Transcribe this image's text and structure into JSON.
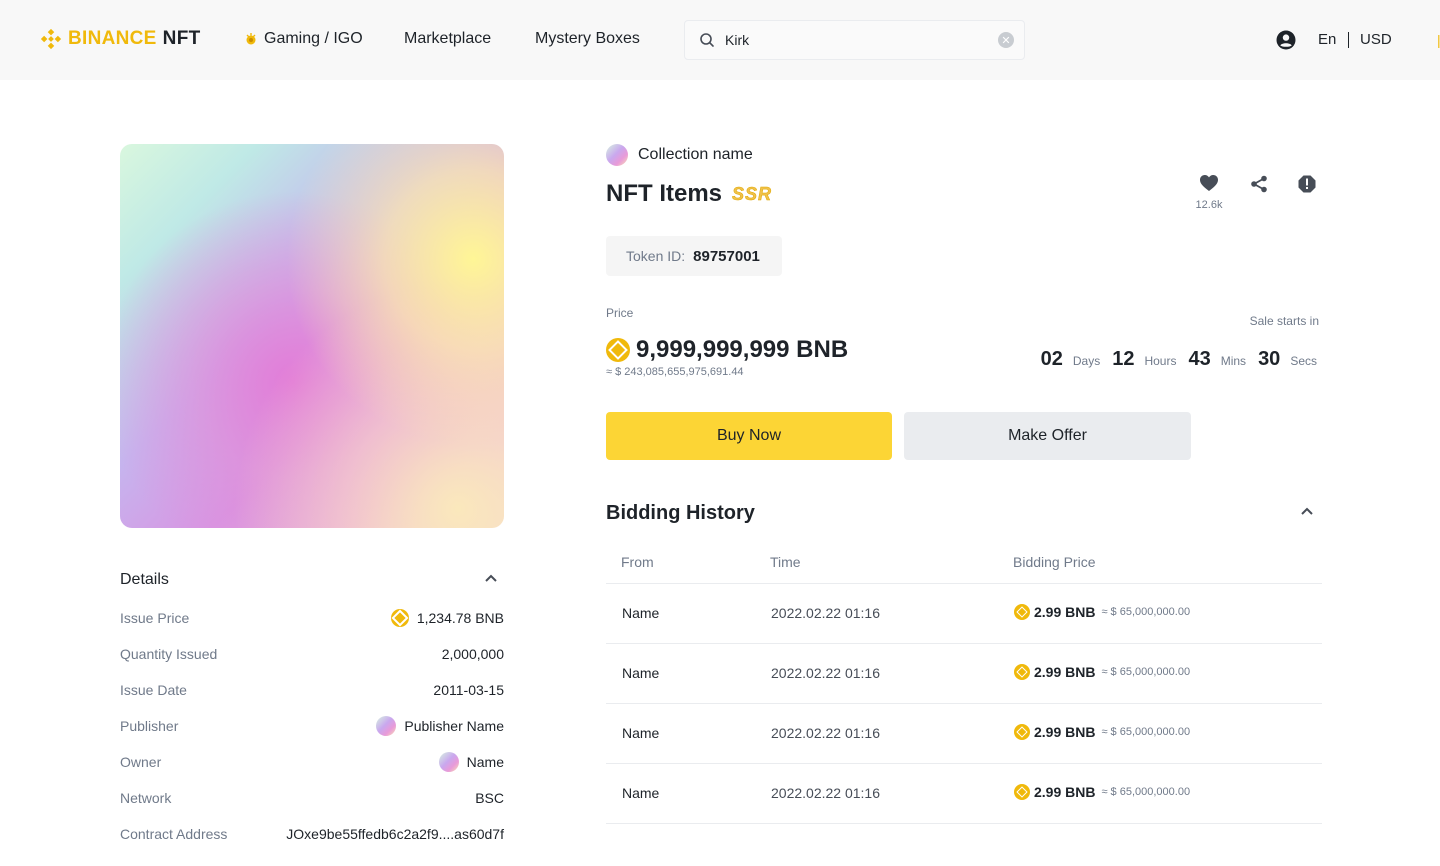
{
  "header": {
    "logo_brand": "BINANCE",
    "logo_product": "NFT",
    "nav": {
      "gaming": "Gaming / IGO",
      "marketplace": "Marketplace",
      "mystery_boxes": "Mystery Boxes"
    },
    "search": {
      "value": "Kirk",
      "placeholder": ""
    },
    "language": "En",
    "currency": "USD"
  },
  "item": {
    "collection_name": "Collection name",
    "title": "NFT Items",
    "rarity_badge": "SSR",
    "favorites_count": "12.6k",
    "token_id_label": "Token ID:",
    "token_id": "89757001",
    "price_label": "Price",
    "price": "9,999,999,999 BNB",
    "price_usd": "≈ $ 243,085,655,975,691.44",
    "sale_label": "Sale starts in",
    "countdown": {
      "days": "02",
      "days_unit": "Days",
      "hours": "12",
      "hours_unit": "Hours",
      "mins": "43",
      "mins_unit": "Mins",
      "secs": "30",
      "secs_unit": "Secs"
    },
    "buy_label": "Buy Now",
    "offer_label": "Make Offer"
  },
  "details": {
    "title": "Details",
    "rows": [
      {
        "label": "Issue Price",
        "value": "1,234.78 BNB"
      },
      {
        "label": "Quantity Issued",
        "value": "2,000,000"
      },
      {
        "label": "Issue Date",
        "value": "2011-03-15"
      },
      {
        "label": "Publisher",
        "value": "Publisher Name"
      },
      {
        "label": "Owner",
        "value": "Name"
      },
      {
        "label": "Network",
        "value": "BSC"
      },
      {
        "label": "Contract Address",
        "value": "JOxe9be55ffedb6c2a2f9....as60d7f"
      }
    ]
  },
  "bidding": {
    "title": "Bidding History",
    "columns": [
      "From",
      "Time",
      "Bidding Price"
    ],
    "rows": [
      {
        "from": "Name",
        "time": "2022.02.22 01:16",
        "price": "2.99 BNB",
        "usd": "≈ $ 65,000,000.00"
      },
      {
        "from": "Name",
        "time": "2022.02.22 01:16",
        "price": "2.99 BNB",
        "usd": "≈ $ 65,000,000.00"
      },
      {
        "from": "Name",
        "time": "2022.02.22 01:16",
        "price": "2.99 BNB",
        "usd": "≈ $ 65,000,000.00"
      },
      {
        "from": "Name",
        "time": "2022.02.22 01:16",
        "price": "2.99 BNB",
        "usd": "≈ $ 65,000,000.00"
      }
    ]
  },
  "colors": {
    "brand_yellow": "#f0b90b",
    "buy_button": "#fcd535",
    "offer_button": "#eaecef",
    "text_primary": "#1e2329",
    "text_secondary": "#707a8a"
  },
  "icons": [
    "binance-logo-icon",
    "gaming-icon",
    "search-icon",
    "clear-icon",
    "user-icon",
    "heart-icon",
    "share-icon",
    "report-icon",
    "chevron-up-icon",
    "bnb-coin-icon"
  ]
}
